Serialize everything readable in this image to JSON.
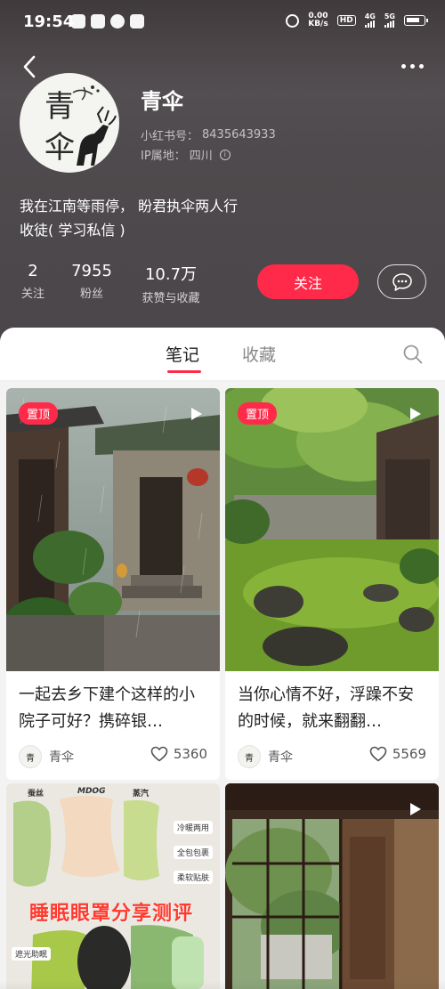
{
  "status_bar": {
    "time": "19:54",
    "net_speed_value": "0.00",
    "net_speed_unit": "KB/s",
    "hd_label": "HD",
    "sim1_label": "4G",
    "sim2_label": "5G"
  },
  "profile": {
    "nickname": "青伞",
    "red_id_label": "小红书号：",
    "red_id": "8435643933",
    "ip_label": "IP属地：",
    "ip_location": "四川",
    "bio_line1": "我在江南等雨停， 盼君执伞两人行",
    "bio_line2": "收徒( 学习私信 )",
    "avatar_text_1": "青",
    "avatar_text_2": "伞"
  },
  "stats": [
    {
      "value": "2",
      "label": "关注"
    },
    {
      "value": "7955",
      "label": "粉丝"
    },
    {
      "value": "10.7万",
      "label": "获赞与收藏"
    }
  ],
  "actions": {
    "follow_label": "关注"
  },
  "tabs": [
    {
      "label": "笔记",
      "active": true
    },
    {
      "label": "收藏",
      "active": false
    }
  ],
  "notes": [
    {
      "pinned": true,
      "pin_label": "置顶",
      "is_video": true,
      "title": "一起去乡下建个这样的小院子可好？携碎银…",
      "author": "青伞",
      "likes": "5360"
    },
    {
      "pinned": true,
      "pin_label": "置顶",
      "is_video": true,
      "title": "当你心情不好，浮躁不安的时候，就来翻翻…",
      "author": "青伞",
      "likes": "5569"
    },
    {
      "pinned": false,
      "is_video": false,
      "cover_texts": [
        "睡眠眼罩分享测评",
        "冷暖两用",
        "全包包裹",
        "柔软贴肤",
        "遮光助眠",
        "MDOG"
      ]
    },
    {
      "pinned": false,
      "is_video": true
    }
  ],
  "colors": {
    "accent": "#ff2a49",
    "header_bg": "#4e4a4d"
  }
}
